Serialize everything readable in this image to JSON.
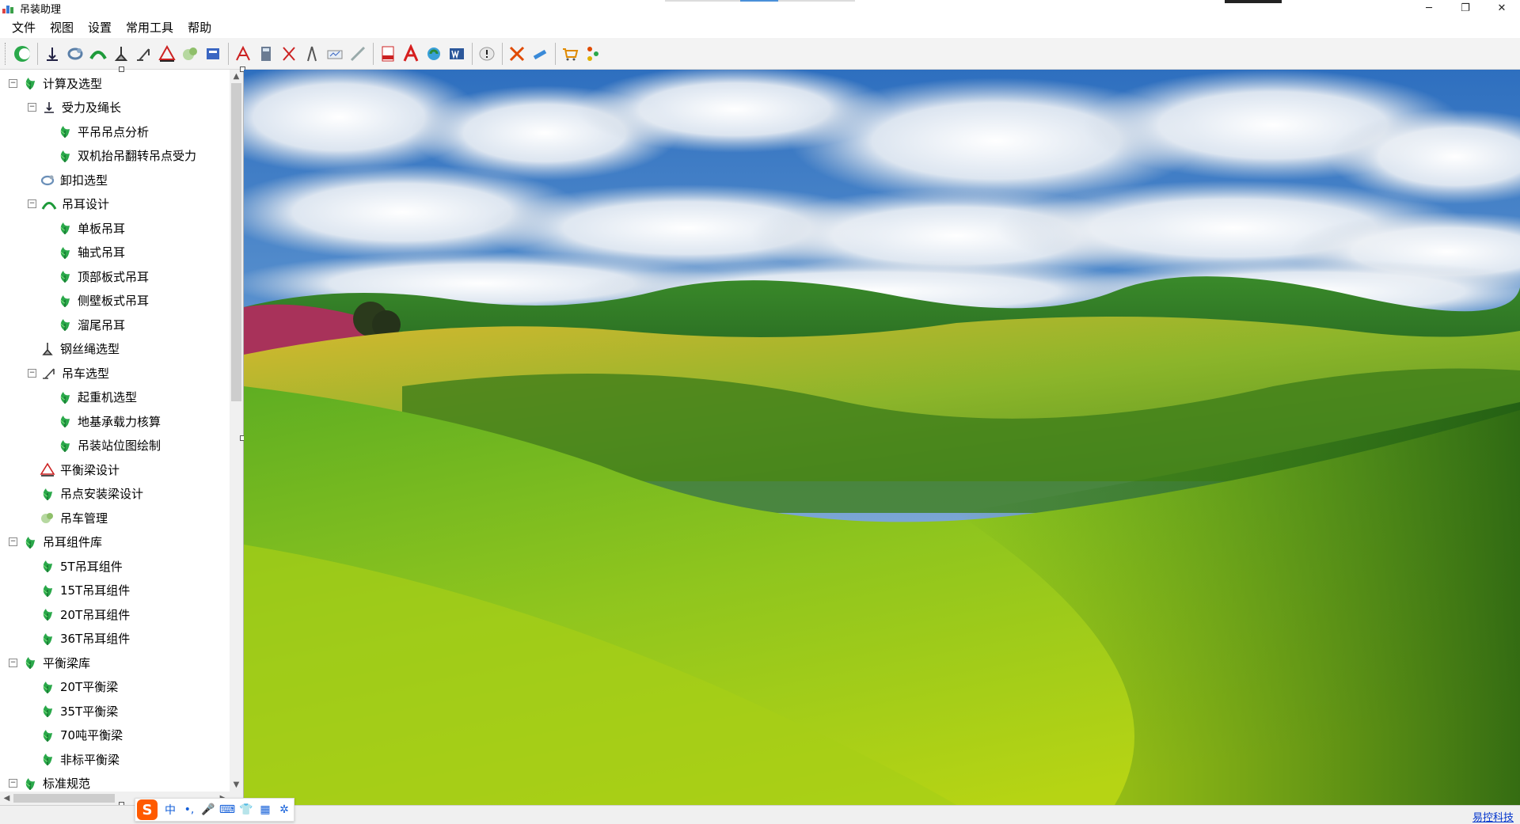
{
  "window": {
    "title": "吊装助理",
    "controls": {
      "minimize": "─",
      "restore": "❐",
      "close": "✕"
    }
  },
  "menu": [
    "文件",
    "视图",
    "设置",
    "常用工具",
    "帮助"
  ],
  "toolbar_icons": [
    "home-icon",
    "force-icon",
    "shackle-icon",
    "lug-icon",
    "wire-rope-icon",
    "crane-icon",
    "balance-beam-icon",
    "crane-manage-icon",
    "report-icon",
    "text-tool-icon",
    "calculator-icon",
    "measure-icon",
    "compass-icon",
    "drawing-icon",
    "pencil-icon",
    "pdf-icon",
    "acrobat-icon",
    "refresh-globe-icon",
    "word-icon",
    "warning-icon",
    "tools-icon",
    "link-icon",
    "cart-icon",
    "network-icon"
  ],
  "tree": [
    {
      "label": "计算及选型",
      "level": 0,
      "expander": "−",
      "icon": "leaf"
    },
    {
      "label": "受力及绳长",
      "level": 1,
      "expander": "−",
      "icon": "force"
    },
    {
      "label": "平吊吊点分析",
      "level": 2,
      "icon": "leaf"
    },
    {
      "label": "双机抬吊翻转吊点受力",
      "level": 2,
      "icon": "leaf"
    },
    {
      "label": "卸扣选型",
      "level": 1,
      "icon": "shackle"
    },
    {
      "label": "吊耳设计",
      "level": 1,
      "expander": "−",
      "icon": "lug"
    },
    {
      "label": "单板吊耳",
      "level": 2,
      "icon": "leaf"
    },
    {
      "label": "轴式吊耳",
      "level": 2,
      "icon": "leaf"
    },
    {
      "label": "顶部板式吊耳",
      "level": 2,
      "icon": "leaf"
    },
    {
      "label": "侧壁板式吊耳",
      "level": 2,
      "icon": "leaf"
    },
    {
      "label": "溜尾吊耳",
      "level": 2,
      "icon": "leaf"
    },
    {
      "label": "钢丝绳选型",
      "level": 1,
      "icon": "wire"
    },
    {
      "label": "吊车选型",
      "level": 1,
      "expander": "−",
      "icon": "crane"
    },
    {
      "label": "起重机选型",
      "level": 2,
      "icon": "leaf"
    },
    {
      "label": "地基承载力核算",
      "level": 2,
      "icon": "leaf"
    },
    {
      "label": "吊装站位图绘制",
      "level": 2,
      "icon": "leaf"
    },
    {
      "label": "平衡梁设计",
      "level": 1,
      "icon": "beam"
    },
    {
      "label": "吊点安装梁设计",
      "level": 1,
      "icon": "leaf"
    },
    {
      "label": "吊车管理",
      "level": 1,
      "icon": "manage"
    },
    {
      "label": "吊耳组件库",
      "level": 0,
      "expander": "−",
      "icon": "leaf"
    },
    {
      "label": "5T吊耳组件",
      "level": 1,
      "icon": "leaf"
    },
    {
      "label": "15T吊耳组件",
      "level": 1,
      "icon": "leaf"
    },
    {
      "label": "20T吊耳组件",
      "level": 1,
      "icon": "leaf"
    },
    {
      "label": "36T吊耳组件",
      "level": 1,
      "icon": "leaf"
    },
    {
      "label": "平衡梁库",
      "level": 0,
      "expander": "−",
      "icon": "leaf"
    },
    {
      "label": "20T平衡梁",
      "level": 1,
      "icon": "leaf"
    },
    {
      "label": "35T平衡梁",
      "level": 1,
      "icon": "leaf"
    },
    {
      "label": "70吨平衡梁",
      "level": 1,
      "icon": "leaf"
    },
    {
      "label": "非标平衡梁",
      "level": 1,
      "icon": "leaf"
    },
    {
      "label": "标准规范",
      "level": 0,
      "expander": "−",
      "icon": "leaf"
    }
  ],
  "scroll": {
    "up": "▲",
    "down": "▼",
    "left": "◀",
    "right": "▶"
  },
  "status": {
    "link": "易控科技"
  },
  "ime": {
    "logo": "S",
    "mode": "中",
    "punct": "•,",
    "mic": "🎤",
    "keyboard": "⌨",
    "skin": "👕",
    "apps": "▦",
    "settings": "✲"
  }
}
